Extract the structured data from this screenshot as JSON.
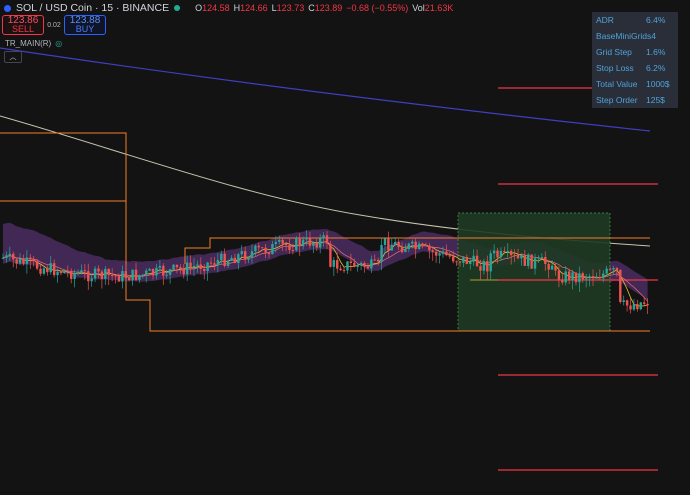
{
  "header": {
    "symbol": "SOL / USD Coin · 15 · BINANCE",
    "open_label": "O",
    "open": "124.58",
    "high_label": "H",
    "high": "124.66",
    "low_label": "L",
    "low": "123.73",
    "close_label": "C",
    "close": "123.89",
    "change": "−0.68 (−0.55%)",
    "vol_label": "Vol",
    "volume": "21.63K"
  },
  "trade": {
    "sell_price": "123.86",
    "sell_label": "SELL",
    "spread": "0.02",
    "buy_price": "123.88",
    "buy_label": "BUY"
  },
  "indicator": {
    "name": "TR_MAIN(R)",
    "collapse_icon": "chevron-up-icon"
  },
  "stats": [
    {
      "label": "ADR",
      "value": "6.4%"
    },
    {
      "label": "BaseMiniGrids",
      "value": "4"
    },
    {
      "label": "Grid Step",
      "value": "1.6%"
    },
    {
      "label": "Stop Loss",
      "value": "6.2%"
    },
    {
      "label": "Total Value",
      "value": "1000$"
    },
    {
      "label": "Step Order",
      "value": "125$"
    }
  ],
  "colors": {
    "background": "#131313",
    "up": "#26a69a",
    "down": "#ef5350",
    "grid_line": "#f23645",
    "range_box": "#f57c2a",
    "zone_fill": "#1e3a24",
    "ribbon": "#6a3a8a",
    "slow_ma": "#e8e3c8",
    "long_ma": "#3f3fc4",
    "stats_text": "#4fa3d8"
  }
}
